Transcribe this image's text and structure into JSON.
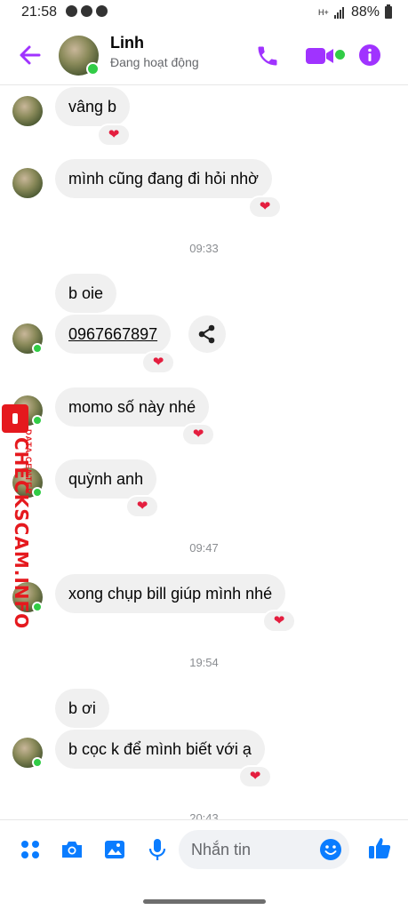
{
  "status_bar": {
    "time": "21:58",
    "network": "H+",
    "battery": "88%"
  },
  "header": {
    "name": "Linh",
    "status": "Đang hoạt động"
  },
  "watermark": {
    "brand": "CHECKSCAM.INFO",
    "sub": "DATA CENTER"
  },
  "messages": [
    {
      "text": "vâng b",
      "reaction": "❤"
    },
    {
      "text": "mình cũng đang đi hỏi nhờ",
      "reaction": "❤"
    },
    {
      "timestamp": "09:33"
    },
    {
      "text": "b oie"
    },
    {
      "text": "0967667897",
      "reaction": "❤"
    },
    {
      "text": "momo số này nhé",
      "reaction": "❤"
    },
    {
      "text": "quỳnh anh",
      "reaction": "❤"
    },
    {
      "timestamp": "09:47"
    },
    {
      "text": "xong chụp bill giúp mình nhé",
      "reaction": "❤"
    },
    {
      "timestamp": "19:54"
    },
    {
      "text": "b ơi"
    },
    {
      "text": "b cọc k để mình biết với ạ",
      "reaction": "❤"
    },
    {
      "timestamp": "20:43"
    }
  ],
  "composer": {
    "placeholder": "Nhắn tin"
  },
  "colors": {
    "accent": "#a033ff",
    "messenger_blue": "#0a7cff",
    "online": "#31cc46",
    "bubble": "#f0f0f0",
    "watermark": "#e5191e"
  },
  "icons": [
    "back-arrow-icon",
    "phone-icon",
    "video-icon",
    "info-icon",
    "share-icon",
    "apps-icon",
    "camera-icon",
    "gallery-icon",
    "microphone-icon",
    "emoji-icon",
    "like-icon"
  ]
}
